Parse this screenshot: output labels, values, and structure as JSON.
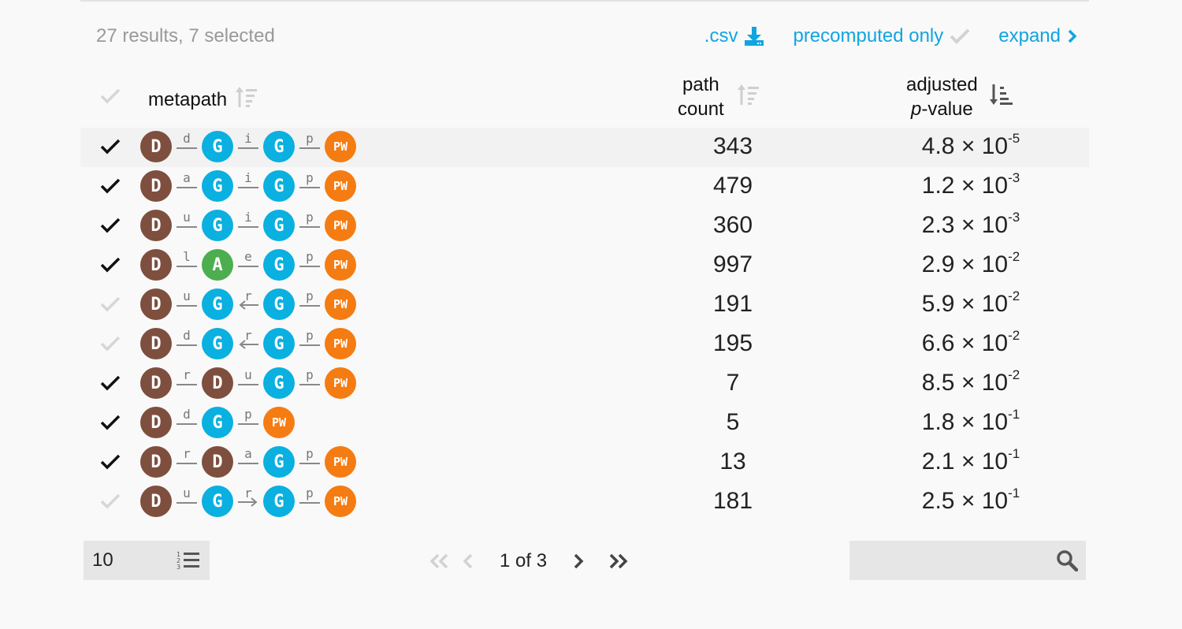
{
  "summary": "27 results, 7 selected",
  "actions": {
    "csv_label": ".csv",
    "precomputed_label": "precomputed only",
    "expand_label": "expand"
  },
  "colors": {
    "accent": "#10a5e0",
    "disease": "#7e4f3e",
    "gene": "#0ab0e0",
    "anatomy": "#4cae4f",
    "pathway": "#f57c12"
  },
  "header": {
    "metapath": "metapath",
    "count_line1": "path",
    "count_line2": "count",
    "pval_line1": "adjusted",
    "pval_p": "p",
    "pval_rest": "-value"
  },
  "rows": [
    {
      "selected": true,
      "nodes": [
        "D",
        "G",
        "G",
        "PW"
      ],
      "edges": [
        {
          "label": "d",
          "dir": "none"
        },
        {
          "label": "i",
          "dir": "none"
        },
        {
          "label": "p",
          "dir": "none"
        }
      ],
      "count": "343",
      "p_mantissa": "4.8",
      "p_exp": "-5"
    },
    {
      "selected": true,
      "nodes": [
        "D",
        "G",
        "G",
        "PW"
      ],
      "edges": [
        {
          "label": "a",
          "dir": "none"
        },
        {
          "label": "i",
          "dir": "none"
        },
        {
          "label": "p",
          "dir": "none"
        }
      ],
      "count": "479",
      "p_mantissa": "1.2",
      "p_exp": "-3"
    },
    {
      "selected": true,
      "nodes": [
        "D",
        "G",
        "G",
        "PW"
      ],
      "edges": [
        {
          "label": "u",
          "dir": "none"
        },
        {
          "label": "i",
          "dir": "none"
        },
        {
          "label": "p",
          "dir": "none"
        }
      ],
      "count": "360",
      "p_mantissa": "2.3",
      "p_exp": "-3"
    },
    {
      "selected": true,
      "nodes": [
        "D",
        "A",
        "G",
        "PW"
      ],
      "edges": [
        {
          "label": "l",
          "dir": "none"
        },
        {
          "label": "e",
          "dir": "none"
        },
        {
          "label": "p",
          "dir": "none"
        }
      ],
      "count": "997",
      "p_mantissa": "2.9",
      "p_exp": "-2"
    },
    {
      "selected": false,
      "nodes": [
        "D",
        "G",
        "G",
        "PW"
      ],
      "edges": [
        {
          "label": "u",
          "dir": "none"
        },
        {
          "label": "r",
          "dir": "left"
        },
        {
          "label": "p",
          "dir": "none"
        }
      ],
      "count": "191",
      "p_mantissa": "5.9",
      "p_exp": "-2"
    },
    {
      "selected": false,
      "nodes": [
        "D",
        "G",
        "G",
        "PW"
      ],
      "edges": [
        {
          "label": "d",
          "dir": "none"
        },
        {
          "label": "r",
          "dir": "left"
        },
        {
          "label": "p",
          "dir": "none"
        }
      ],
      "count": "195",
      "p_mantissa": "6.6",
      "p_exp": "-2"
    },
    {
      "selected": true,
      "nodes": [
        "D",
        "D",
        "G",
        "PW"
      ],
      "edges": [
        {
          "label": "r",
          "dir": "none"
        },
        {
          "label": "u",
          "dir": "none"
        },
        {
          "label": "p",
          "dir": "none"
        }
      ],
      "count": "7",
      "p_mantissa": "8.5",
      "p_exp": "-2"
    },
    {
      "selected": true,
      "nodes": [
        "D",
        "G",
        "PW"
      ],
      "edges": [
        {
          "label": "d",
          "dir": "none"
        },
        {
          "label": "p",
          "dir": "none"
        }
      ],
      "count": "5",
      "p_mantissa": "1.8",
      "p_exp": "-1"
    },
    {
      "selected": true,
      "nodes": [
        "D",
        "D",
        "G",
        "PW"
      ],
      "edges": [
        {
          "label": "r",
          "dir": "none"
        },
        {
          "label": "a",
          "dir": "none"
        },
        {
          "label": "p",
          "dir": "none"
        }
      ],
      "count": "13",
      "p_mantissa": "2.1",
      "p_exp": "-1"
    },
    {
      "selected": false,
      "nodes": [
        "D",
        "G",
        "G",
        "PW"
      ],
      "edges": [
        {
          "label": "u",
          "dir": "none"
        },
        {
          "label": "r",
          "dir": "right"
        },
        {
          "label": "p",
          "dir": "none"
        }
      ],
      "count": "181",
      "p_mantissa": "2.5",
      "p_exp": "-1"
    }
  ],
  "times_ten": "× 10",
  "footer": {
    "per_page": "10",
    "page_text": "1 of 3",
    "search_value": ""
  }
}
